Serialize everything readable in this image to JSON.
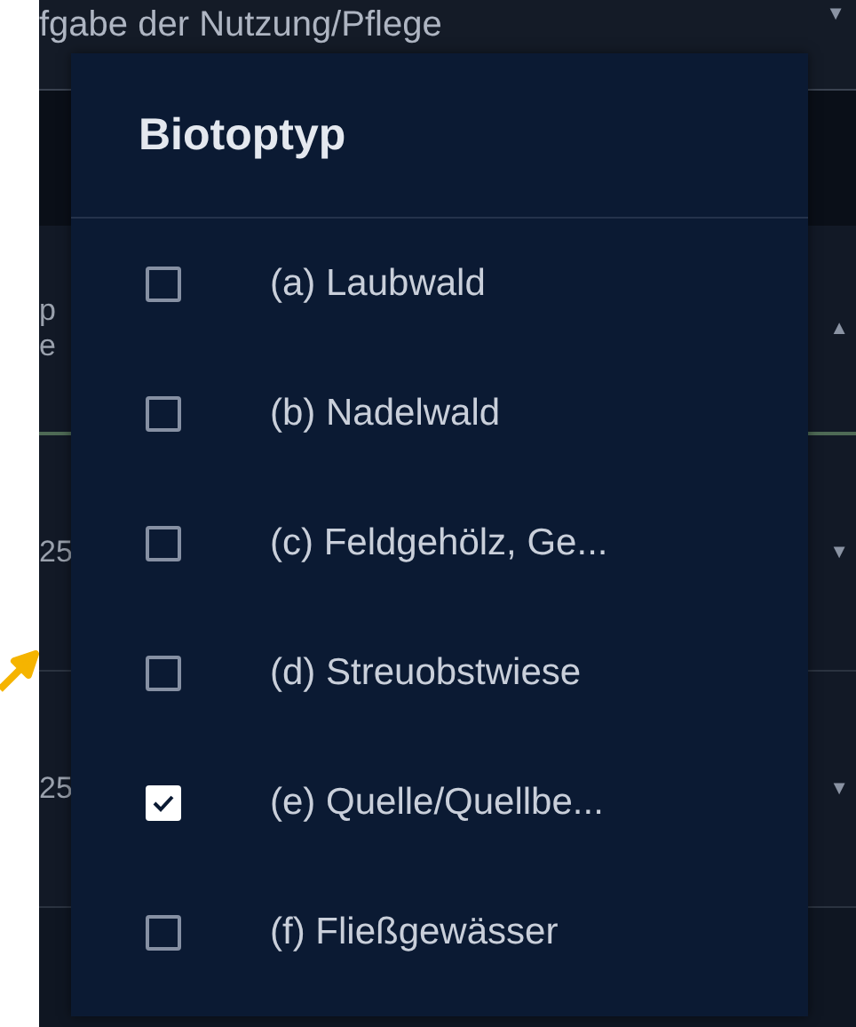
{
  "background": {
    "heading": "fgabe der Nutzung/Pflege",
    "heading_caret": "▼",
    "rows": [
      {
        "texts": [
          "p",
          "e"
        ],
        "caret": "▲"
      },
      {
        "texts": [
          "25"
        ],
        "caret": "▼"
      },
      {
        "texts": [
          "25"
        ],
        "caret": "▼"
      }
    ]
  },
  "dialog": {
    "title": "Biotoptyp",
    "options": [
      {
        "label": "(a) Laubwald",
        "checked": false
      },
      {
        "label": "(b) Nadelwald",
        "checked": false
      },
      {
        "label": "(c) Feldgehölz, Ge...",
        "checked": false
      },
      {
        "label": "(d) Streuobstwiese",
        "checked": false
      },
      {
        "label": "(e) Quelle/Quellbe...",
        "checked": true
      },
      {
        "label": "(f) Fließgewässer",
        "checked": false
      }
    ]
  }
}
